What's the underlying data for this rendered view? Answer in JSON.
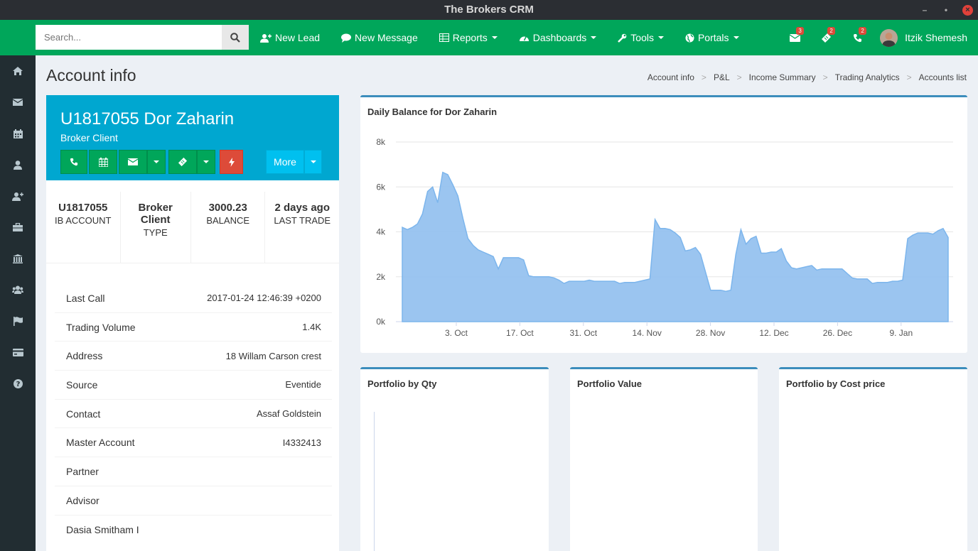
{
  "window": {
    "title": "The Brokers CRM"
  },
  "search": {
    "placeholder": "Search..."
  },
  "nav": {
    "new_lead": "New Lead",
    "new_message": "New Message",
    "reports": "Reports",
    "dashboards": "Dashboards",
    "tools": "Tools",
    "portals": "Portals"
  },
  "notifications": {
    "messages": "3",
    "tickets": "2",
    "calls": "2"
  },
  "user": {
    "name": "Itzik Shemesh"
  },
  "page": {
    "title": "Account info"
  },
  "breadcrumb": [
    "Account info",
    "P&L",
    "Income Summary",
    "Trading Analytics",
    "Accounts list"
  ],
  "profile": {
    "name": "U1817055 Dor Zaharin",
    "type": "Broker Client",
    "more_label": "More"
  },
  "stats": [
    {
      "value": "U1817055",
      "label": "IB ACCOUNT"
    },
    {
      "value": "Broker Client",
      "label": "TYPE"
    },
    {
      "value": "3000.23",
      "label": "BALANCE"
    },
    {
      "value": "2 days ago",
      "label": "LAST TRADE"
    }
  ],
  "info": [
    {
      "label": "Last Call",
      "value": "2017-01-24 12:46:39 +0200"
    },
    {
      "label": "Trading Volume",
      "value": "1.4K"
    },
    {
      "label": "Address",
      "value": "18 Willam Carson crest"
    },
    {
      "label": "Source",
      "value": "Eventide"
    },
    {
      "label": "Contact",
      "value": "Assaf Goldstein"
    },
    {
      "label": "Master Account",
      "value": "I4332413"
    },
    {
      "label": "Partner",
      "value": ""
    },
    {
      "label": "Advisor",
      "value": ""
    },
    {
      "label": "Dasia Smitham I",
      "value": ""
    }
  ],
  "boxes": {
    "balance": "Daily Balance for Dor Zaharin",
    "qty": "Portfolio by Qty",
    "value": "Portfolio Value",
    "cost": "Portfolio by Cost price"
  },
  "colors": {
    "green": "#00a65a",
    "blue": "#00a7d0",
    "sidebar": "#222d32",
    "area": "#90bfee"
  },
  "chart_data": {
    "type": "area",
    "title": "Daily Balance for Dor Zaharin",
    "ylim": [
      0,
      8000
    ],
    "yticks": [
      "0k",
      "2k",
      "4k",
      "6k",
      "8k"
    ],
    "xticks": [
      "3. Oct",
      "17. Oct",
      "31. Oct",
      "14. Nov",
      "28. Nov",
      "12. Dec",
      "26. Dec",
      "9. Jan"
    ],
    "grid": true,
    "series": [
      {
        "values": [
          4200,
          4100,
          4200,
          4350,
          4800,
          5800,
          6000,
          5300,
          6650,
          6550,
          6100,
          5600,
          4600,
          3700,
          3400,
          3200,
          3100,
          3000,
          2900,
          2350,
          2850,
          2850,
          2850,
          2850,
          2750,
          2050,
          2000,
          2000,
          2000,
          2000,
          1950,
          1850,
          1700,
          1800,
          1800,
          1800,
          1800,
          1850,
          1800,
          1800,
          1800,
          1800,
          1800,
          1700,
          1750,
          1750,
          1750,
          1800,
          1850,
          1900,
          4550,
          4150,
          4150,
          4100,
          3950,
          3750,
          3150,
          3200,
          3300,
          3000,
          2200,
          1400,
          1400,
          1400,
          1350,
          1400,
          3000,
          4100,
          3450,
          3700,
          3800,
          3050,
          3050,
          3100,
          3100,
          3250,
          2700,
          2400,
          2350,
          2400,
          2450,
          2500,
          2300,
          2350,
          2350,
          2350,
          2350,
          2350,
          2150,
          1950,
          1900,
          1900,
          1900,
          1700,
          1750,
          1750,
          1750,
          1800,
          1800,
          1850,
          3700,
          3850,
          3950,
          3950,
          3950,
          3900,
          4050,
          4150,
          3750
        ]
      }
    ]
  }
}
